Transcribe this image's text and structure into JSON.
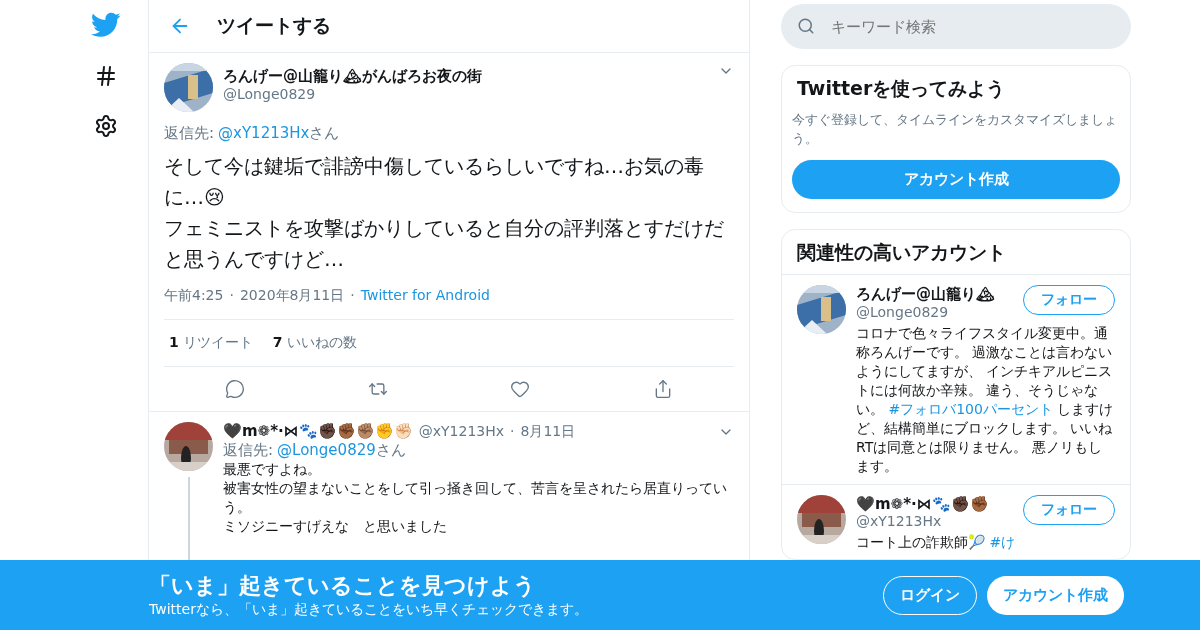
{
  "header": {
    "title": "ツイートする"
  },
  "tweet": {
    "name": "ろんげー@山籠り🏔がんばろお夜の街",
    "handle": "@Longe0829",
    "reply_label": "返信先:",
    "reply_to": "@xY1213Hx",
    "reply_suffix": "さん",
    "text": [
      "そして今は鍵垢で誹謗中傷しているらしいですね…お気の毒に…😢",
      "フェミニストを攻撃ばかりしていると自分の評判落とすだけだと思うんですけど…"
    ],
    "time": "午前4:25",
    "separator": "·",
    "date": "2020年8月11日",
    "separator_2": "·",
    "source": "Twitter for Android",
    "stats": [
      {
        "count": "1",
        "label": "リツイート"
      },
      {
        "count": "7",
        "label": "いいねの数"
      }
    ]
  },
  "replies": [
    {
      "name": "🖤m❁*·⋈🐾✊🏿✊🏾✊🏽✊✊🏻",
      "handle": "@xY1213Hx",
      "separator": "·",
      "date": "8月11日",
      "reply_label": "返信先:",
      "reply_to": "@Longe0829",
      "reply_suffix": "さん",
      "text": [
        "最悪ですよね。",
        "被害女性の望まないことをして引っ掻き回して、苦言を呈されたら居直りっていう。",
        "ミソジニーすげえな　と思いました"
      ]
    }
  ],
  "search": {
    "placeholder": "キーワード検索"
  },
  "signup_card": {
    "title": "Twitterを使ってみよう",
    "text": "今すぐ登録して、タイムラインをカスタマイズしましょう。",
    "button": "アカウント作成"
  },
  "related": {
    "title": "関連性の高いアカウント",
    "accounts": [
      {
        "name": "ろんげー@山籠り🏔",
        "handle": "@Longe0829",
        "button": "フォロー",
        "bio": [
          {
            "kind": "text",
            "text": "コロナで色々ライフスタイル変更中。通称ろんげーです。 過激なことは言わないようにしてますが、 インチキアルピニストには何故か辛辣。 違う、そうじゃない。 "
          },
          {
            "kind": "hashtag",
            "text": "#フォロバ100パーセント"
          },
          {
            "kind": "text",
            "text": " しますけど、結構簡単にブロックします。 いいねRTは同意とは限りません。 悪ノリもします。"
          }
        ]
      },
      {
        "name": "🖤m❁*·⋈🐾✊🏿✊🏾",
        "handle": "@xY1213Hx",
        "button": "フォロー",
        "bio": [
          {
            "kind": "text",
            "text": "コート上の詐欺師🎾 "
          },
          {
            "kind": "hashtag",
            "text": "#け"
          }
        ]
      }
    ]
  },
  "banner": {
    "title": "「いま」起きていることを見つけよう",
    "subtitle": "Twitterなら、「いま」起きていることをいち早くチェックできます。",
    "login": "ログイン",
    "signup": "アカウント作成"
  }
}
